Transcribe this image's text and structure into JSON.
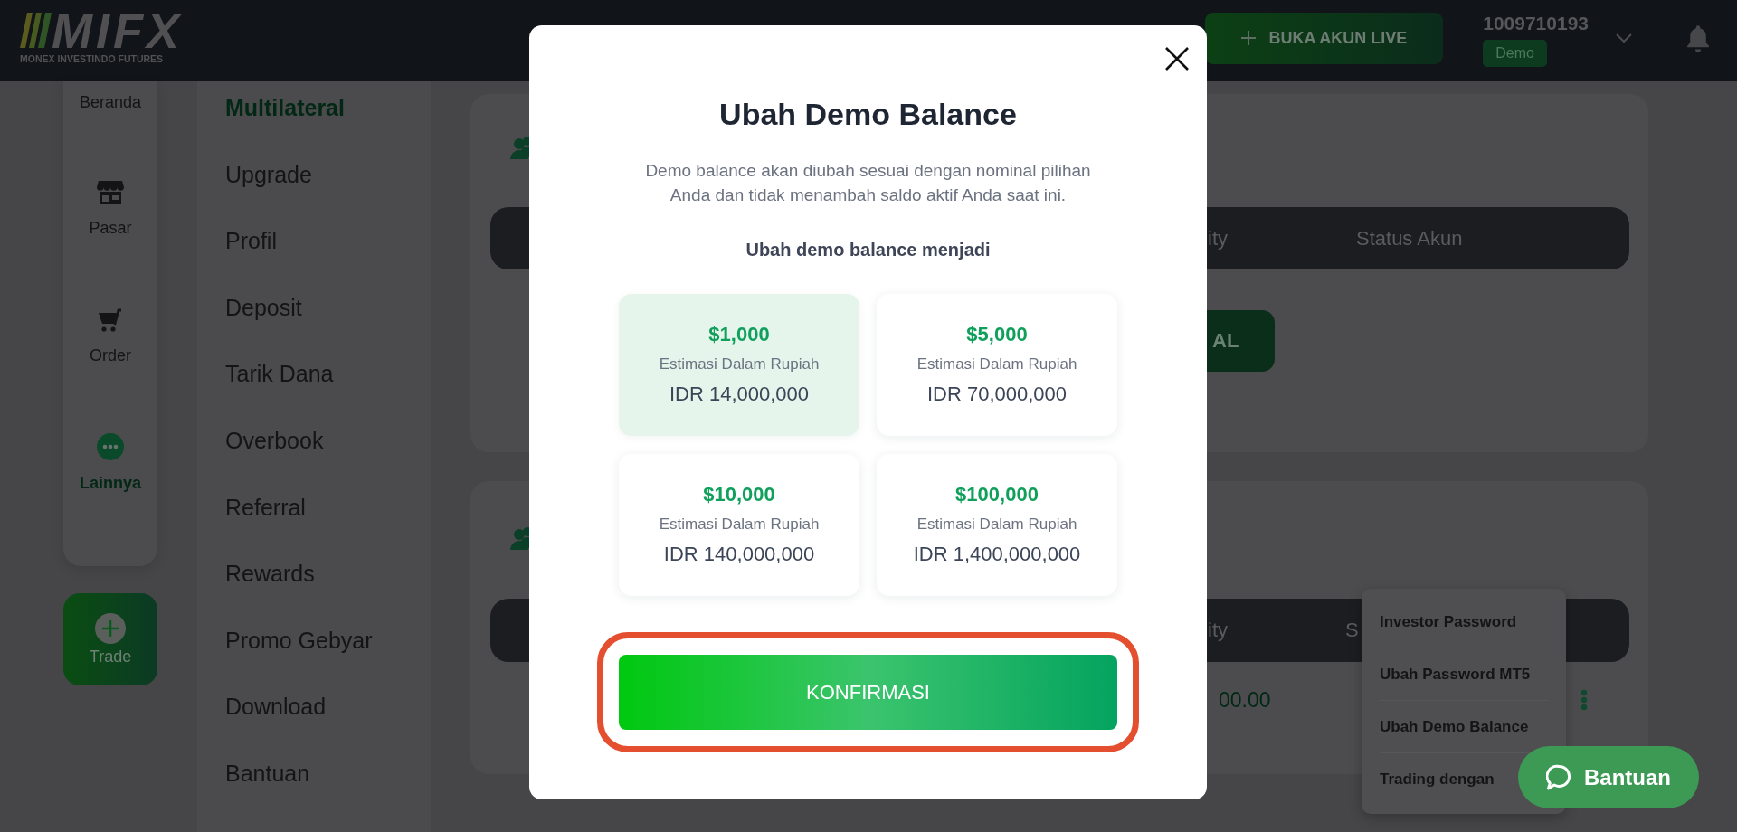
{
  "top_bar": {
    "logo": {
      "wordmark": "MIFX",
      "tagline": "MONEX INVESTINDO FUTURES"
    },
    "live_account_button": "BUKA AKUN LIVE",
    "account_number": "1009710193",
    "account_badge": "Demo"
  },
  "nav_rail": {
    "items": [
      {
        "label": "Beranda",
        "selected": false
      },
      {
        "label": "Pasar",
        "selected": false
      },
      {
        "label": "Order",
        "selected": false
      },
      {
        "label": "Lainnya",
        "selected": true
      }
    ],
    "trade_button": "Trade"
  },
  "side_menu": {
    "items": [
      {
        "label": "Multilateral",
        "selected": true
      },
      {
        "label": "Upgrade",
        "selected": false
      },
      {
        "label": "Profil",
        "selected": false
      },
      {
        "label": "Deposit",
        "selected": false
      },
      {
        "label": "Tarik Dana",
        "selected": false
      },
      {
        "label": "Overbook",
        "selected": false
      },
      {
        "label": "Referral",
        "selected": false
      },
      {
        "label": "Rewards",
        "selected": false
      },
      {
        "label": "Promo Gebyar",
        "selected": false
      },
      {
        "label": "Download",
        "selected": false
      },
      {
        "label": "Bantuan",
        "selected": false
      }
    ]
  },
  "account_cards": [
    {
      "columns": [
        "ity",
        "Status Akun"
      ],
      "action_button": "AL"
    },
    {
      "columns": [
        "ity",
        "S"
      ],
      "rows": [
        [
          "00.00"
        ]
      ]
    }
  ],
  "context_menu": {
    "items": [
      "Investor Password",
      "Ubah Password MT5",
      "Ubah Demo Balance",
      "Trading dengan"
    ]
  },
  "modal": {
    "title": "Ubah Demo Balance",
    "description": "Demo balance akan diubah sesuai dengan nominal pilihan Anda dan tidak menambah saldo aktif Anda saat ini.",
    "subtitle": "Ubah demo balance menjadi",
    "options": [
      {
        "amount": "$1,000",
        "caption": "Estimasi Dalam Rupiah",
        "rupiah": "IDR 14,000,000",
        "selected": true
      },
      {
        "amount": "$5,000",
        "caption": "Estimasi Dalam Rupiah",
        "rupiah": "IDR 70,000,000",
        "selected": false
      },
      {
        "amount": "$10,000",
        "caption": "Estimasi Dalam Rupiah",
        "rupiah": "IDR 140,000,000",
        "selected": false
      },
      {
        "amount": "$100,000",
        "caption": "Estimasi Dalam Rupiah",
        "rupiah": "IDR 1,400,000,000",
        "selected": false
      }
    ],
    "confirm_button": {
      "label": "KONFIRMASI",
      "highlighted": true
    }
  },
  "help_button": "Bantuan"
}
